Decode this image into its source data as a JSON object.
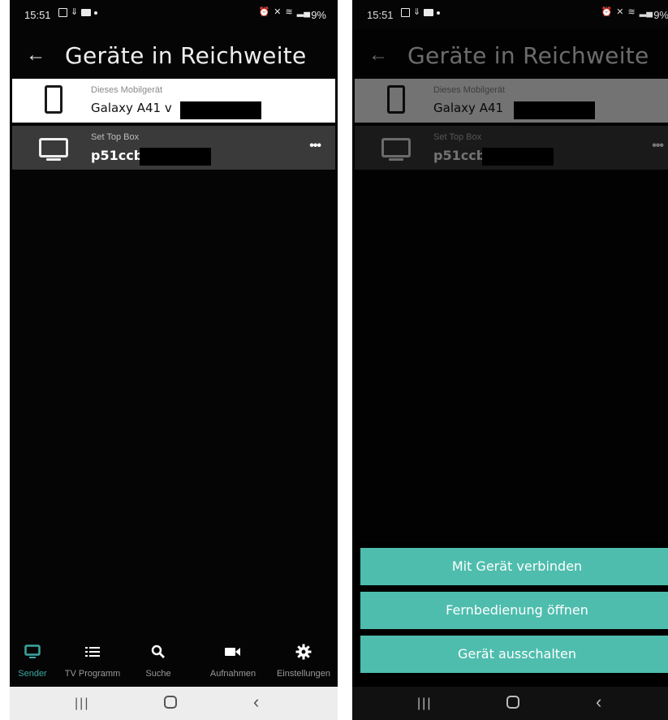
{
  "status_bar": {
    "time": "15:51",
    "battery": "9%"
  },
  "header": {
    "title": "Geräte in Reichweite"
  },
  "devices": [
    {
      "type": "Dieses Mobilgerät",
      "name": "Galaxy A41 v",
      "icon": "smartphone-icon"
    },
    {
      "type": "Set Top Box",
      "name": "p51ccb",
      "icon": "tv-icon"
    }
  ],
  "devices_right": [
    {
      "type": "Dieses Mobilgerät",
      "name": "Galaxy A41"
    },
    {
      "type": "Set Top Box",
      "name": "p51ccb"
    }
  ],
  "bottom_nav": [
    {
      "label": "Sender",
      "icon": "tv-icon",
      "active": true
    },
    {
      "label": "TV Programm",
      "icon": "list-icon"
    },
    {
      "label": "Suche",
      "icon": "search-icon"
    },
    {
      "label": "Aufnahmen",
      "icon": "video-camera-icon"
    },
    {
      "label": "Einstellungen",
      "icon": "gear-icon"
    }
  ],
  "action_sheet": [
    {
      "label": "Mit Gerät verbinden"
    },
    {
      "label": "Fernbedienung öffnen"
    },
    {
      "label": "Gerät ausschalten"
    }
  ],
  "colors": {
    "accent": "#4ebdad",
    "active_nav": "#3aa6a0",
    "background": "#050505"
  }
}
